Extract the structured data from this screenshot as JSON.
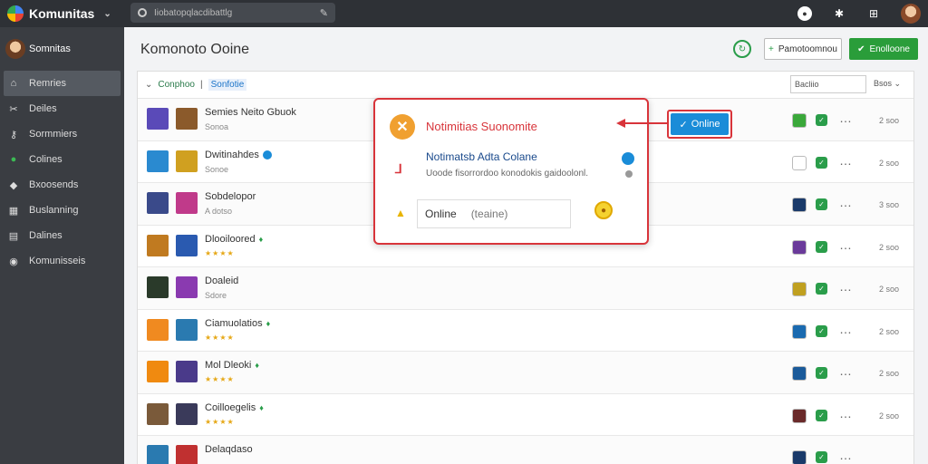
{
  "topbar": {
    "brand": "Komunitas",
    "search_placeholder": "Iiobatopqlacdibattlg"
  },
  "sidebar": {
    "user": "Somnitas",
    "items": [
      {
        "label": "Remries",
        "icon": "home-icon",
        "active": true
      },
      {
        "label": "Deiles",
        "icon": "tools-icon"
      },
      {
        "label": "Sormmiers",
        "icon": "key-icon"
      },
      {
        "label": "Colines",
        "icon": "globe-icon"
      },
      {
        "label": "Bxoosends",
        "icon": "tag-icon"
      },
      {
        "label": "Buslanning",
        "icon": "grid-icon"
      },
      {
        "label": "Dalines",
        "icon": "calendar-icon"
      },
      {
        "label": "Komunisseis",
        "icon": "location-icon"
      }
    ]
  },
  "main": {
    "title": "Komonoto Ooine",
    "btn_outline": "Pamotoomnou",
    "btn_green": "Enolloone",
    "filter": {
      "label": "Conphoo",
      "chip": "Sonfotie",
      "search_value": "Bacliio",
      "sort_label": "Bsos"
    },
    "rows": [
      {
        "title": "Semies Neito Gbuok",
        "sub": "Sonoa",
        "stars": "",
        "verified": false,
        "leaf": false,
        "time": "2 soo",
        "c1": "#5a4ab8",
        "c2": "#8b5a2b",
        "a1": "#3aa83a"
      },
      {
        "title": "Dwitinahdes",
        "sub": "Sonoe",
        "stars": "",
        "verified": true,
        "leaf": false,
        "time": "2 soo",
        "c1": "#2a8ad0",
        "c2": "#d0a020",
        "a1": "#fff"
      },
      {
        "title": "Sobdelopor",
        "sub": "A dotso",
        "stars": "",
        "verified": false,
        "leaf": false,
        "time": "3 soo",
        "c1": "#3a4a8a",
        "c2": "#c03a8a",
        "a1": "#1a3a6a"
      },
      {
        "title": "Dlooiloored",
        "sub": "",
        "stars": "★★★★",
        "verified": false,
        "leaf": true,
        "time": "2 soo",
        "c1": "#c07a20",
        "c2": "#2a5ab0",
        "a1": "#6a3a9a"
      },
      {
        "title": "Doaleid",
        "sub": "Sdore",
        "stars": "",
        "verified": false,
        "leaf": false,
        "time": "2 soo",
        "c1": "#2a3a2a",
        "c2": "#8a3ab0",
        "a1": "#c0a020"
      },
      {
        "title": "Ciamuolatios",
        "sub": "",
        "stars": "★★★★",
        "verified": false,
        "leaf": true,
        "time": "2 soo",
        "c1": "#f08a20",
        "c2": "#2a7ab0",
        "a1": "#1a6ab0"
      },
      {
        "title": "Mol Dleoki",
        "sub": "",
        "stars": "★★★★",
        "verified": false,
        "leaf": true,
        "time": "2 soo",
        "c1": "#f08a10",
        "c2": "#4a3a8a",
        "a1": "#1a5a9a"
      },
      {
        "title": "Coilloegelis",
        "sub": "",
        "stars": "★★★★",
        "verified": false,
        "leaf": true,
        "time": "2 soo",
        "c1": "#7a5a3a",
        "c2": "#3a3a5a",
        "a1": "#6a2a2a"
      },
      {
        "title": "Delaqdaso",
        "sub": "",
        "stars": "",
        "verified": false,
        "leaf": false,
        "time": "",
        "c1": "#2a7ab0",
        "c2": "#c03030",
        "a1": "#1a3a6a"
      }
    ]
  },
  "popup": {
    "title": "Notimitias Suonomite",
    "subtitle": "Notimatsb Adta Colane",
    "desc": "Uoode fisorrordoo konodokis gaidoolonl.",
    "input_label": "Online",
    "input_placeholder": "(teaine)"
  },
  "online_badge": "Online",
  "colors": {
    "accent": "#2a9d3a",
    "alert": "#d8343a",
    "link": "#1a8cd8"
  }
}
